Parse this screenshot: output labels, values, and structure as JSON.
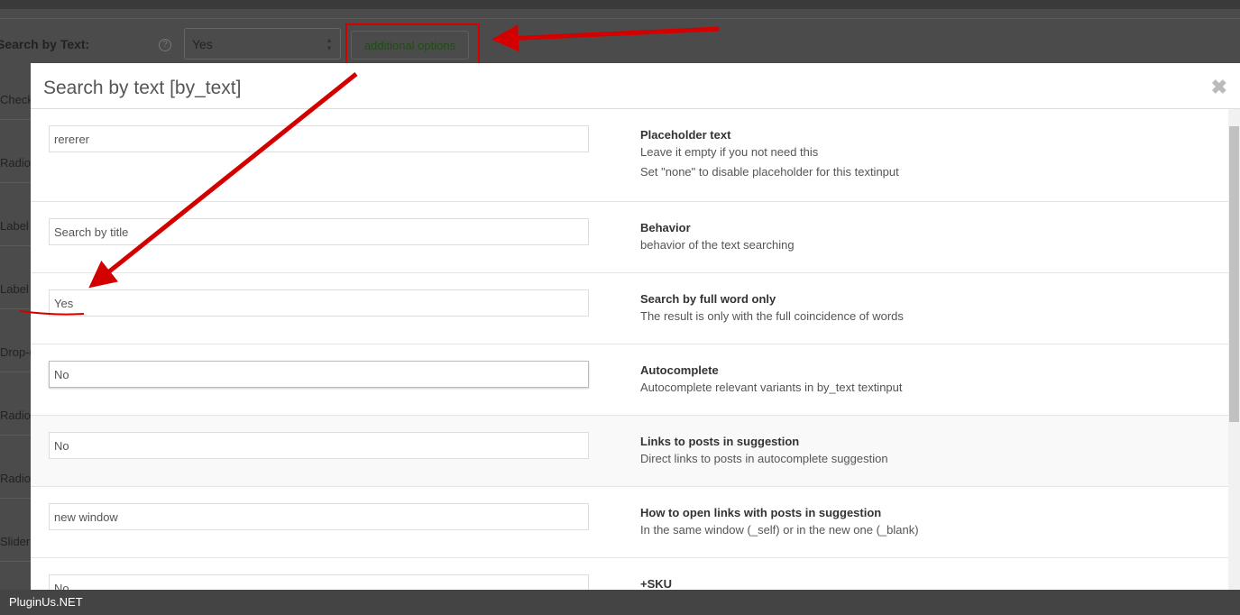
{
  "background": {
    "field_label": "Search by Text:",
    "select_value": "Yes",
    "additional_options_label": "additional options",
    "side_labels": [
      "Check",
      "Radio",
      "Label",
      "Label",
      "Drop-d",
      "Radio",
      "Radio",
      "Slider"
    ]
  },
  "modal": {
    "title": "Search by text [by_text]",
    "rows": [
      {
        "value": "rererer",
        "title": "Placeholder text",
        "desc": [
          "Leave it empty if you not need this",
          "Set \"none\" to disable placeholder for this textinput"
        ]
      },
      {
        "value": "Search by title",
        "title": "Behavior",
        "desc": [
          "behavior of the text searching"
        ]
      },
      {
        "value": "Yes",
        "title": "Search by full word only",
        "desc": [
          "The result is only with the full coincidence of words"
        ]
      },
      {
        "value": "No",
        "title": "Autocomplete",
        "desc": [
          "Autocomplete relevant variants in by_text textinput"
        ]
      },
      {
        "value": "No",
        "title": "Links to posts in suggestion",
        "desc": [
          "Direct links to posts in autocomplete suggestion"
        ]
      },
      {
        "value": "new window",
        "title": "How to open links with posts in suggestion",
        "desc": [
          "In the same window (_self) or in the new one (_blank)"
        ]
      },
      {
        "value": "No",
        "title": "+SKU",
        "desc": []
      }
    ]
  },
  "footer": {
    "brand": "PluginUs.NET"
  },
  "colors": {
    "annotation": "#d40000"
  }
}
